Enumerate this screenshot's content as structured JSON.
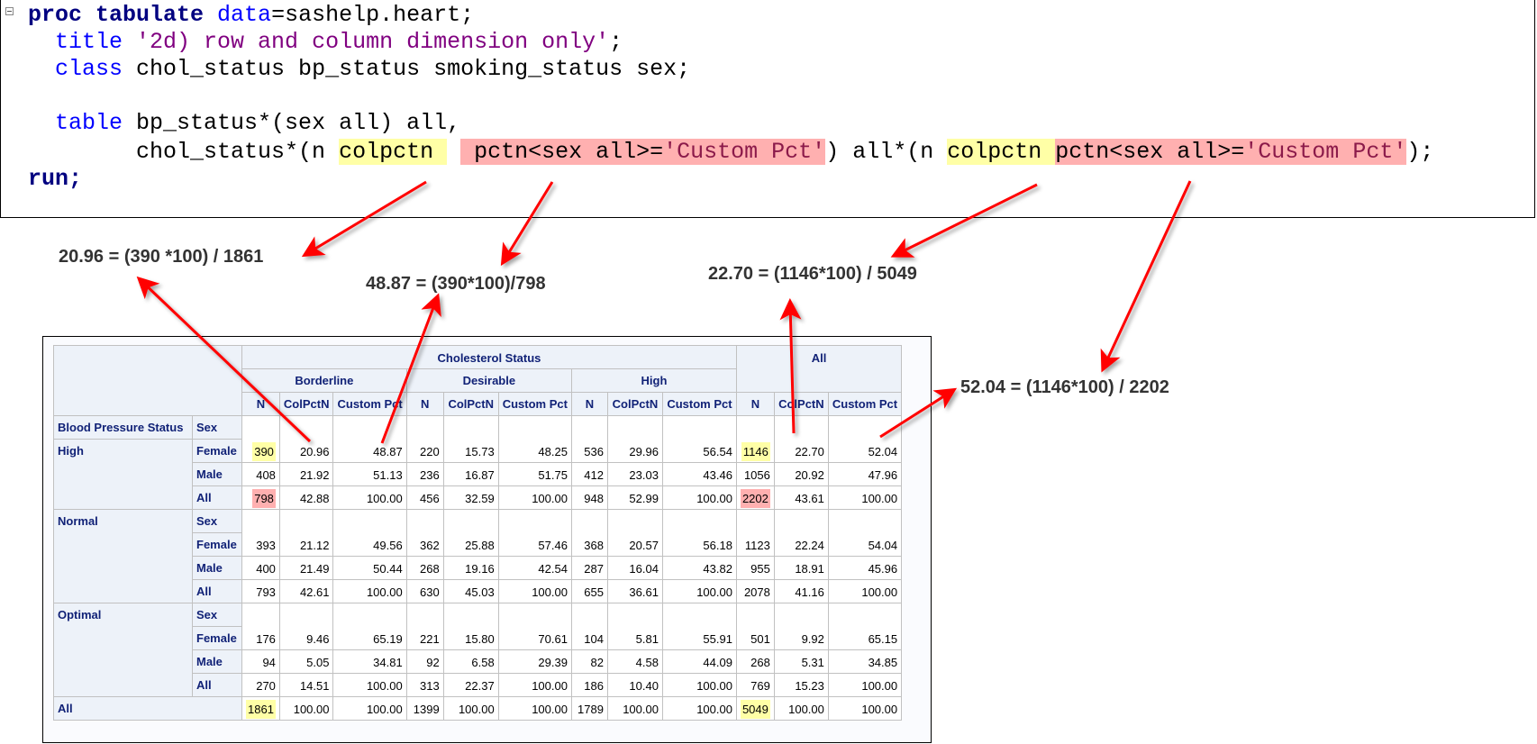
{
  "code": {
    "lines": [
      [
        {
          "t": "proc tabulate ",
          "c": "kw"
        },
        {
          "t": "data",
          "c": "blue"
        },
        {
          "t": "=sashelp.heart;",
          "c": ""
        }
      ],
      [
        {
          "t": "  ",
          "c": ""
        },
        {
          "t": "title ",
          "c": "blue"
        },
        {
          "t": "'2d) row and column dimension only'",
          "c": "str"
        },
        {
          "t": ";",
          "c": ""
        }
      ],
      [
        {
          "t": "  ",
          "c": ""
        },
        {
          "t": "class ",
          "c": "blue"
        },
        {
          "t": "chol_status bp_status smoking_status sex;",
          "c": ""
        }
      ],
      [],
      [
        {
          "t": "  ",
          "c": ""
        },
        {
          "t": "table ",
          "c": "blue"
        },
        {
          "t": "bp_status*(sex all) all,",
          "c": ""
        }
      ],
      [
        {
          "t": "        chol_status*(n ",
          "c": ""
        },
        {
          "t": "colpctn ",
          "c": "hly"
        },
        {
          "t": " ",
          "c": ""
        },
        {
          "t": " pctn<sex all>=",
          "c": "hlp"
        },
        {
          "t": "'Custom Pct'",
          "c": "hlp-str"
        },
        {
          "t": ") all*(n ",
          "c": ""
        },
        {
          "t": "colpctn ",
          "c": "hly"
        },
        {
          "t": "pctn<sex all>=",
          "c": "hlp"
        },
        {
          "t": "'Custom Pct'",
          "c": "hlp-str"
        },
        {
          "t": ");",
          "c": ""
        }
      ],
      [
        {
          "t": "run;",
          "c": "kw"
        }
      ]
    ]
  },
  "annotations": [
    "20.96 = (390 *100) / 1861",
    "48.87 = (390*100)/798",
    "22.70 = (1146*100) / 5049",
    "52.04 = (1146*100) / 2202"
  ],
  "colors": {
    "arrow": "#ff0000",
    "highlight_yellow": "#ffffa6",
    "highlight_pink": "#ffb0b0",
    "header_bg": "#edf2f9",
    "header_text": "#112277"
  },
  "table": {
    "top_header": "Cholesterol Status",
    "all_header": "All",
    "groups": [
      "Borderline",
      "Desirable",
      "High"
    ],
    "stats": [
      "N",
      "ColPctN",
      "Custom Pct"
    ],
    "row_header_1": "Blood Pressure Status",
    "row_header_2": "Sex",
    "bp_groups": [
      {
        "label": "High",
        "sex_row": false,
        "rows": [
          {
            "sex": "Female",
            "values": [
              "390",
              "20.96",
              "48.87",
              "220",
              "15.73",
              "48.25",
              "536",
              "29.96",
              "56.54",
              "1146",
              "22.70",
              "52.04"
            ]
          },
          {
            "sex": "Male",
            "values": [
              "408",
              "21.92",
              "51.13",
              "236",
              "16.87",
              "51.75",
              "412",
              "23.03",
              "43.46",
              "1056",
              "20.92",
              "47.96"
            ]
          },
          {
            "sex": "All",
            "values": [
              "798",
              "42.88",
              "100.00",
              "456",
              "32.59",
              "100.00",
              "948",
              "52.99",
              "100.00",
              "2202",
              "43.61",
              "100.00"
            ]
          }
        ]
      },
      {
        "label": "Normal",
        "sex_row": true,
        "sex_label": "Sex",
        "rows": [
          {
            "sex": "Female",
            "values": [
              "393",
              "21.12",
              "49.56",
              "362",
              "25.88",
              "57.46",
              "368",
              "20.57",
              "56.18",
              "1123",
              "22.24",
              "54.04"
            ]
          },
          {
            "sex": "Male",
            "values": [
              "400",
              "21.49",
              "50.44",
              "268",
              "19.16",
              "42.54",
              "287",
              "16.04",
              "43.82",
              "955",
              "18.91",
              "45.96"
            ]
          },
          {
            "sex": "All",
            "values": [
              "793",
              "42.61",
              "100.00",
              "630",
              "45.03",
              "100.00",
              "655",
              "36.61",
              "100.00",
              "2078",
              "41.16",
              "100.00"
            ]
          }
        ]
      },
      {
        "label": "Optimal",
        "sex_row": true,
        "sex_label": "Sex",
        "rows": [
          {
            "sex": "Female",
            "values": [
              "176",
              "9.46",
              "65.19",
              "221",
              "15.80",
              "70.61",
              "104",
              "5.81",
              "55.91",
              "501",
              "9.92",
              "65.15"
            ]
          },
          {
            "sex": "Male",
            "values": [
              "94",
              "5.05",
              "34.81",
              "92",
              "6.58",
              "29.39",
              "82",
              "4.58",
              "44.09",
              "268",
              "5.31",
              "34.85"
            ]
          },
          {
            "sex": "All",
            "values": [
              "270",
              "14.51",
              "100.00",
              "313",
              "22.37",
              "100.00",
              "186",
              "10.40",
              "100.00",
              "769",
              "15.23",
              "100.00"
            ]
          }
        ]
      }
    ],
    "total": {
      "label": "All",
      "values": [
        "1861",
        "100.00",
        "100.00",
        "1399",
        "100.00",
        "100.00",
        "1789",
        "100.00",
        "100.00",
        "5049",
        "100.00",
        "100.00"
      ]
    },
    "highlights": [
      {
        "group": 0,
        "row": 0,
        "col": 0,
        "color": "yellow"
      },
      {
        "group": 0,
        "row": 2,
        "col": 0,
        "color": "pink"
      },
      {
        "group": 0,
        "row": 0,
        "col": 9,
        "color": "yellow"
      },
      {
        "group": 0,
        "row": 2,
        "col": 9,
        "color": "pink"
      },
      {
        "group": "total",
        "col": 0,
        "color": "yellow"
      },
      {
        "group": "total",
        "col": 9,
        "color": "yellow"
      }
    ]
  }
}
